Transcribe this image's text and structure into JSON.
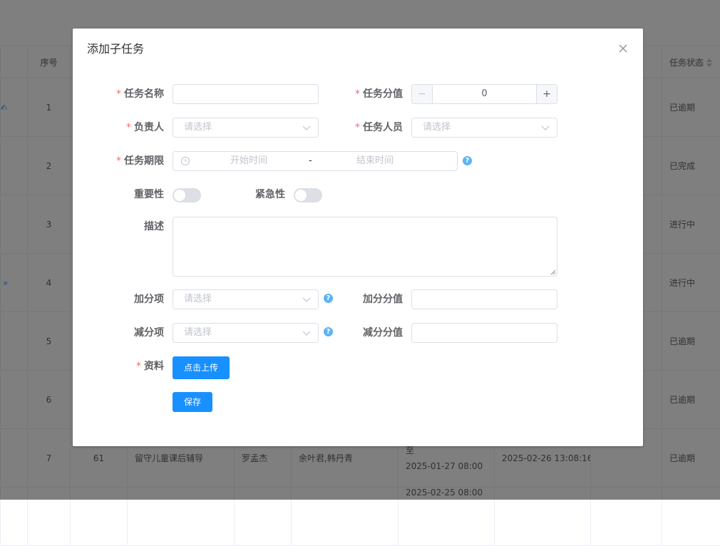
{
  "background": {
    "headers": [
      "序号",
      "任务状态"
    ],
    "rows": [
      {
        "index": "1",
        "status": "已逾期"
      },
      {
        "index": "2",
        "status": "已完成"
      },
      {
        "index": "3",
        "status": "进行中"
      },
      {
        "index": "4",
        "status": "进行中"
      },
      {
        "index": "5",
        "status": "已逾期"
      },
      {
        "index": "6",
        "status": "已逾期"
      },
      {
        "index": "7",
        "id": "61",
        "name": "留守儿童课后辅导",
        "owner": "罗孟杰",
        "members": "余叶君,韩丹青",
        "period_to": "至",
        "period_end": "2025-01-27 08:00",
        "created": "2025-02-26 13:08:16",
        "status": "已逾期"
      }
    ],
    "partial_row_date": "2025-02-25 08:00"
  },
  "dialog": {
    "title": "添加子任务",
    "fields": {
      "task_name": {
        "label": "任务名称",
        "value": ""
      },
      "task_score": {
        "label": "任务分值",
        "value": "0",
        "minus": "−",
        "plus": "+"
      },
      "owner": {
        "label": "负责人",
        "placeholder": "请选择"
      },
      "members": {
        "label": "任务人员",
        "placeholder": "请选择"
      },
      "period": {
        "label": "任务期限",
        "start_placeholder": "开始时间",
        "separator": "-",
        "end_placeholder": "结束时间"
      },
      "important": {
        "label": "重要性"
      },
      "urgent": {
        "label": "紧急性"
      },
      "description": {
        "label": "描述",
        "value": ""
      },
      "bonus_item": {
        "label": "加分项",
        "placeholder": "请选择"
      },
      "bonus_value": {
        "label": "加分分值",
        "value": ""
      },
      "penalty_item": {
        "label": "减分项",
        "placeholder": "请选择"
      },
      "penalty_value": {
        "label": "减分分值",
        "value": ""
      },
      "material": {
        "label": "资料",
        "upload_label": "点击上传"
      }
    },
    "required_mark": "*",
    "help_mark": "?",
    "save_label": "保存"
  },
  "icons": {
    "close": "close-icon",
    "arrow": "chevron-down-icon",
    "clock": "clock-icon",
    "help": "question-circle-icon"
  },
  "colors": {
    "primary": "#1890ff",
    "required": "#f56c6c",
    "help": "#5cb3f5",
    "overlay": "rgba(0,0,0,0.5)"
  }
}
